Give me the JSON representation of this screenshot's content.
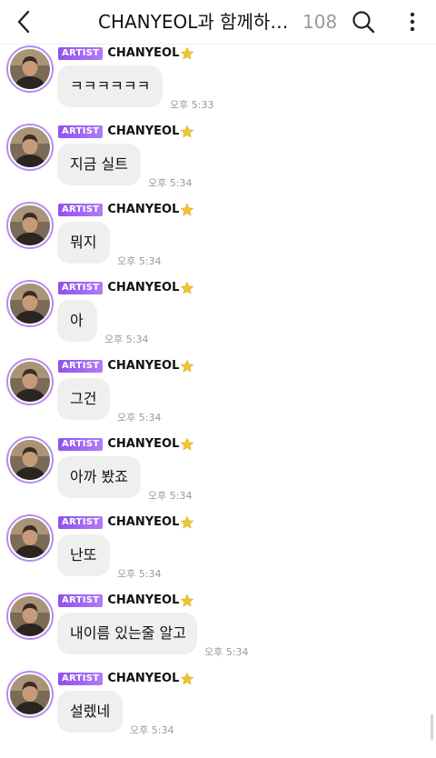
{
  "header": {
    "title": "CHANYEOL과 함께하는...",
    "count": "108"
  },
  "icons": {
    "back": "chevron-left-icon",
    "search": "search-icon",
    "menu": "more-vertical-icon",
    "star": "star-icon"
  },
  "colors": {
    "badge": "#9b5cf0",
    "avatar_ring": "#b68cf0",
    "bubble": "#efefef",
    "time": "#9a9a9a",
    "star": "#f2c530"
  },
  "messages": [
    {
      "badge": "ARTIST",
      "name": "CHANYEOL",
      "text": "ㅋㅋㅋㅋㅋㅋ",
      "time": "오후 5:33"
    },
    {
      "badge": "ARTIST",
      "name": "CHANYEOL",
      "text": "지금 실트",
      "time": "오후 5:34"
    },
    {
      "badge": "ARTIST",
      "name": "CHANYEOL",
      "text": "뭐지",
      "time": "오후 5:34"
    },
    {
      "badge": "ARTIST",
      "name": "CHANYEOL",
      "text": "아",
      "time": "오후 5:34"
    },
    {
      "badge": "ARTIST",
      "name": "CHANYEOL",
      "text": "그건",
      "time": "오후 5:34"
    },
    {
      "badge": "ARTIST",
      "name": "CHANYEOL",
      "text": "아까 봤죠",
      "time": "오후 5:34"
    },
    {
      "badge": "ARTIST",
      "name": "CHANYEOL",
      "text": "난또",
      "time": "오후 5:34"
    },
    {
      "badge": "ARTIST",
      "name": "CHANYEOL",
      "text": "내이름 있는줄 알고",
      "time": "오후 5:34"
    },
    {
      "badge": "ARTIST",
      "name": "CHANYEOL",
      "text": "설렜네",
      "time": "오후 5:34"
    }
  ]
}
